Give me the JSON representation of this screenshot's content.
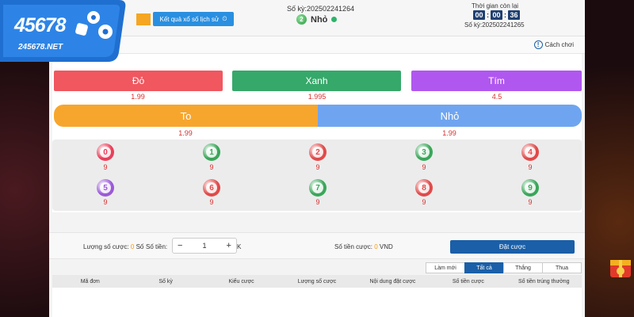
{
  "logo": {
    "main": "45678",
    "sub": "245678.NET"
  },
  "header": {
    "history_button": "Kết quả xổ số lịch sử",
    "current_period": "Số kỳ:202502241264",
    "last_result_number": "2",
    "last_result_text": "Nhỏ",
    "timer_label": "Thời gian còn lại",
    "timer": {
      "hh": "00",
      "mm": "00",
      "ss": "36"
    },
    "next_period": "Số kỳ:202502241265",
    "rules_label": "Cách chơi"
  },
  "colors_bets": [
    {
      "label": "Đỏ",
      "odds": "1.99",
      "color": "#f0575f"
    },
    {
      "label": "Xanh",
      "odds": "1.995",
      "color": "#36a86a"
    },
    {
      "label": "Tím",
      "odds": "4.5",
      "color": "#b057f0"
    }
  ],
  "size_bets": [
    {
      "label": "To",
      "odds": "1.99",
      "color": "#f7a62d"
    },
    {
      "label": "Nhỏ",
      "odds": "1.99",
      "color": "#6fa5f0"
    }
  ],
  "numbers": [
    {
      "n": "0",
      "odds": "9",
      "color": "#e8405a"
    },
    {
      "n": "1",
      "odds": "9",
      "color": "#3aa65a"
    },
    {
      "n": "2",
      "odds": "9",
      "color": "#e04a4a"
    },
    {
      "n": "3",
      "odds": "9",
      "color": "#3aa65a"
    },
    {
      "n": "4",
      "odds": "9",
      "color": "#e04a4a"
    },
    {
      "n": "5",
      "odds": "9",
      "color": "#9b59d6"
    },
    {
      "n": "6",
      "odds": "9",
      "color": "#e04a4a"
    },
    {
      "n": "7",
      "odds": "9",
      "color": "#3aa65a"
    },
    {
      "n": "8",
      "odds": "9",
      "color": "#e04a4a"
    },
    {
      "n": "9",
      "odds": "9",
      "color": "#3aa65a"
    }
  ],
  "betbar": {
    "count_label": "Lượng số cược:",
    "count_value": "0",
    "count_unit": "Số",
    "amount_label": "Số tiền:",
    "amount_value": "1",
    "amount_unit": "K",
    "total_label": "Số tiền cược:",
    "total_value": "0",
    "total_unit": "VND",
    "place_button": "Đặt cược"
  },
  "filters": [
    "Làm mới",
    "Tất cả",
    "Thắng",
    "Thua"
  ],
  "table_headers": [
    "Mã đơn",
    "Số kỳ",
    "Kiểu cược",
    "Lượng số cược",
    "Nội dung đặt cược",
    "Số tiền cược",
    "Số tiền trúng thưởng"
  ]
}
